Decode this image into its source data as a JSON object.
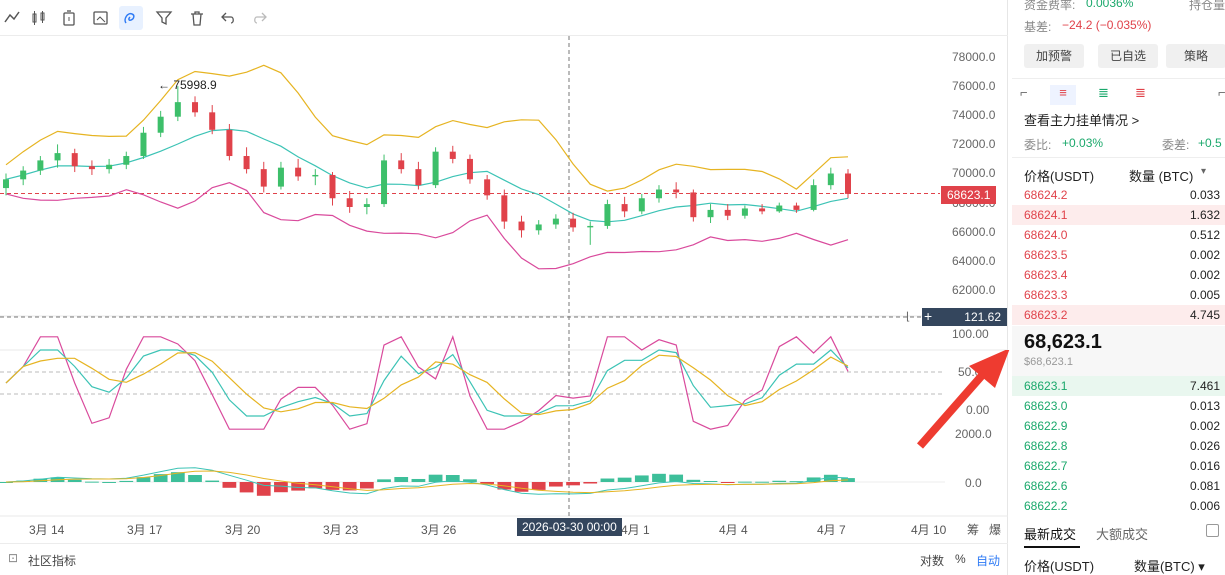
{
  "toolbar": {
    "tools": [
      "trend-line-icon",
      "candle-style-icon",
      "indicator-icon",
      "settings-sheet-icon",
      "magnet-icon",
      "filter-icon",
      "trash-icon",
      "undo-icon",
      "redo-icon"
    ]
  },
  "chart_data": {
    "type": "candlestick",
    "price_axis": [
      "78000.0",
      "76000.0",
      "74000.0",
      "72000.0",
      "70000.0",
      "68000.0",
      "66000.0",
      "64000.0",
      "62000.0"
    ],
    "current_price_label": "68623.1",
    "high_marker": "← 75998.9",
    "indicator_value_label": "121.62",
    "kdj_axis": [
      "100.00",
      "50.00",
      "0.00"
    ],
    "macd_axis": [
      "2000.0",
      "0.0"
    ],
    "x_labels": [
      "3月 14",
      "3月 17",
      "3月 20",
      "3月 23",
      "3月 26",
      "4月 1",
      "4月 4",
      "4月 7",
      "4月 10"
    ],
    "crosshair_time": "2026-03-30 00:00",
    "right_icons": [
      "筹",
      "爆"
    ],
    "ylim": [
      61000,
      79000
    ],
    "up_color": "#3dbf6a",
    "down_color": "#e0424a",
    "candles": [
      {
        "o": 69000,
        "h": 70000,
        "l": 68500,
        "c": 69600
      },
      {
        "o": 69600,
        "h": 70500,
        "l": 69200,
        "c": 70200
      },
      {
        "o": 70200,
        "h": 71200,
        "l": 69900,
        "c": 70900
      },
      {
        "o": 70900,
        "h": 72000,
        "l": 70400,
        "c": 71400
      },
      {
        "o": 71400,
        "h": 71700,
        "l": 70100,
        "c": 70500
      },
      {
        "o": 70500,
        "h": 70900,
        "l": 69900,
        "c": 70300
      },
      {
        "o": 70300,
        "h": 71000,
        "l": 70000,
        "c": 70600
      },
      {
        "o": 70600,
        "h": 71500,
        "l": 70300,
        "c": 71200
      },
      {
        "o": 71200,
        "h": 73200,
        "l": 71000,
        "c": 72800
      },
      {
        "o": 72800,
        "h": 74300,
        "l": 72500,
        "c": 73900
      },
      {
        "o": 73900,
        "h": 75999,
        "l": 73600,
        "c": 74900
      },
      {
        "o": 74900,
        "h": 75300,
        "l": 73900,
        "c": 74200
      },
      {
        "o": 74200,
        "h": 74700,
        "l": 72700,
        "c": 73000
      },
      {
        "o": 73000,
        "h": 73400,
        "l": 70900,
        "c": 71200
      },
      {
        "o": 71200,
        "h": 71800,
        "l": 70000,
        "c": 70300
      },
      {
        "o": 70300,
        "h": 70800,
        "l": 68700,
        "c": 69100
      },
      {
        "o": 69100,
        "h": 70800,
        "l": 68900,
        "c": 70400
      },
      {
        "o": 70400,
        "h": 71000,
        "l": 69500,
        "c": 69800
      },
      {
        "o": 69800,
        "h": 70300,
        "l": 69200,
        "c": 69900
      },
      {
        "o": 69900,
        "h": 70100,
        "l": 67800,
        "c": 68300
      },
      {
        "o": 68300,
        "h": 68800,
        "l": 67300,
        "c": 67700
      },
      {
        "o": 67700,
        "h": 68300,
        "l": 67200,
        "c": 67900
      },
      {
        "o": 67900,
        "h": 71300,
        "l": 67700,
        "c": 70900
      },
      {
        "o": 70900,
        "h": 71400,
        "l": 70000,
        "c": 70300
      },
      {
        "o": 70300,
        "h": 70800,
        "l": 68900,
        "c": 69200
      },
      {
        "o": 69200,
        "h": 71800,
        "l": 69000,
        "c": 71500
      },
      {
        "o": 71500,
        "h": 71900,
        "l": 70700,
        "c": 71000
      },
      {
        "o": 71000,
        "h": 71300,
        "l": 69300,
        "c": 69600
      },
      {
        "o": 69600,
        "h": 69900,
        "l": 68200,
        "c": 68500
      },
      {
        "o": 68500,
        "h": 68900,
        "l": 66200,
        "c": 66700
      },
      {
        "o": 66700,
        "h": 67100,
        "l": 65600,
        "c": 66100
      },
      {
        "o": 66100,
        "h": 66800,
        "l": 65800,
        "c": 66500
      },
      {
        "o": 66500,
        "h": 67200,
        "l": 66200,
        "c": 66900
      },
      {
        "o": 66900,
        "h": 67300,
        "l": 66000,
        "c": 66300
      },
      {
        "o": 66300,
        "h": 66700,
        "l": 65100,
        "c": 66400
      },
      {
        "o": 66400,
        "h": 68200,
        "l": 66200,
        "c": 67900
      },
      {
        "o": 67900,
        "h": 68400,
        "l": 67000,
        "c": 67400
      },
      {
        "o": 67400,
        "h": 68600,
        "l": 67200,
        "c": 68300
      },
      {
        "o": 68300,
        "h": 69200,
        "l": 68000,
        "c": 68900
      },
      {
        "o": 68900,
        "h": 69400,
        "l": 68300,
        "c": 68700
      },
      {
        "o": 68700,
        "h": 68900,
        "l": 66700,
        "c": 67000
      },
      {
        "o": 67000,
        "h": 67900,
        "l": 66600,
        "c": 67500
      },
      {
        "o": 67500,
        "h": 67900,
        "l": 66800,
        "c": 67100
      },
      {
        "o": 67100,
        "h": 67800,
        "l": 66900,
        "c": 67600
      },
      {
        "o": 67600,
        "h": 67900,
        "l": 67200,
        "c": 67400
      },
      {
        "o": 67400,
        "h": 68000,
        "l": 67300,
        "c": 67800
      },
      {
        "o": 67800,
        "h": 68000,
        "l": 67300,
        "c": 67500
      },
      {
        "o": 67500,
        "h": 69600,
        "l": 67400,
        "c": 69200
      },
      {
        "o": 69200,
        "h": 70400,
        "l": 68900,
        "c": 70000
      },
      {
        "o": 70000,
        "h": 70300,
        "l": 68300,
        "c": 68600
      }
    ]
  },
  "panel": {
    "funding_label": "资金费率:",
    "funding_value": "0.0036%",
    "holding_label": "持仓量",
    "basis_label": "基差:",
    "basis_value": "−24.2 (−0.035%)",
    "buttons": [
      "加预警",
      "已自选",
      "策略"
    ],
    "main_orders_link": "查看主力挂单情况 >",
    "ratio_label": "委比:",
    "ratio_value": "+0.03%",
    "diff_label": "委差:",
    "diff_value": "+0.5",
    "price_header": "价格(USDT)",
    "qty_header": "数量 (BTC)",
    "asks": [
      {
        "price": "68624.2",
        "qty": "0.033"
      },
      {
        "price": "68624.1",
        "qty": "1.632"
      },
      {
        "price": "68624.0",
        "qty": "0.512"
      },
      {
        "price": "68623.5",
        "qty": "0.002"
      },
      {
        "price": "68623.4",
        "qty": "0.002"
      },
      {
        "price": "68623.3",
        "qty": "0.005"
      },
      {
        "price": "68623.2",
        "qty": "4.745"
      }
    ],
    "last_price": "68,623.1",
    "last_price_usd": "$68,623.1",
    "bids": [
      {
        "price": "68623.1",
        "qty": "7.461"
      },
      {
        "price": "68623.0",
        "qty": "0.013"
      },
      {
        "price": "68622.9",
        "qty": "0.002"
      },
      {
        "price": "68622.8",
        "qty": "0.026"
      },
      {
        "price": "68622.7",
        "qty": "0.016"
      },
      {
        "price": "68622.6",
        "qty": "0.081"
      },
      {
        "price": "68622.2",
        "qty": "0.006"
      }
    ],
    "tab_latest": "最新成交",
    "tab_large": "大额成交",
    "bottom_price_header": "价格(USDT)",
    "bottom_qty_header": "数量(BTC) ▾"
  },
  "bottom_bar": {
    "community_label": "社区指标",
    "log_label": "对数",
    "percent_label": "%",
    "auto_label": "自动"
  }
}
